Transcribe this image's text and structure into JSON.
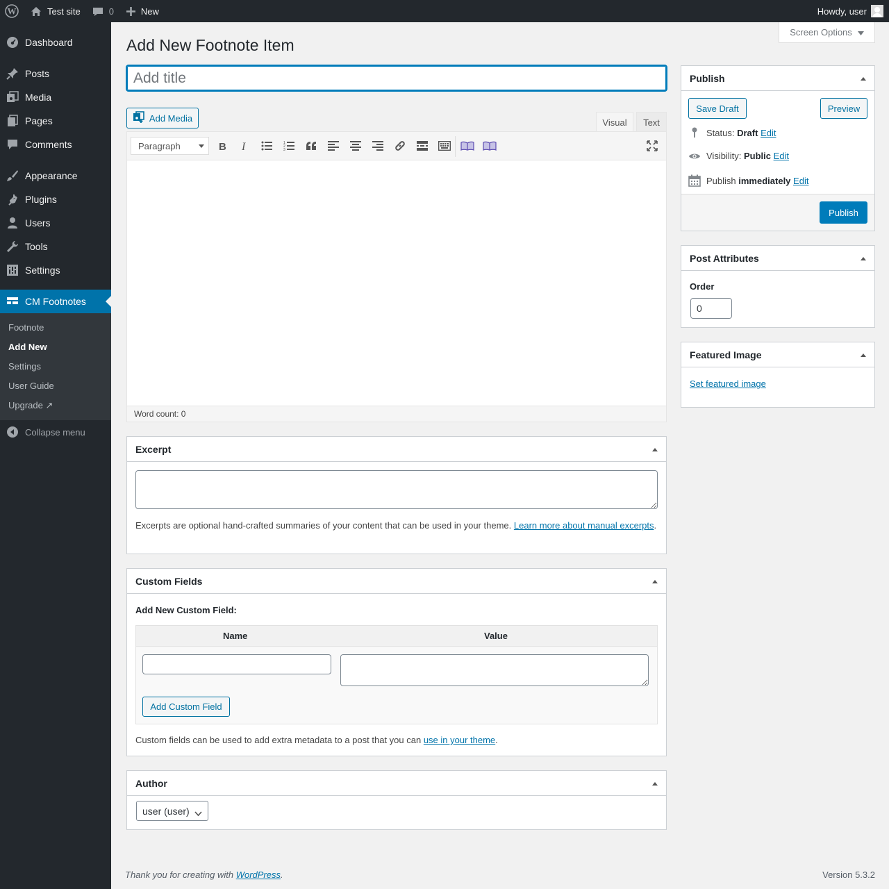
{
  "adminbar": {
    "site_name": "Test site",
    "comments_count": "0",
    "new_label": "New",
    "greeting": "Howdy, user"
  },
  "sidebar": {
    "items": [
      {
        "label": "Dashboard",
        "icon": "dashboard-icon"
      },
      {
        "label": "Posts",
        "icon": "pin-icon"
      },
      {
        "label": "Media",
        "icon": "media-icon"
      },
      {
        "label": "Pages",
        "icon": "pages-icon"
      },
      {
        "label": "Comments",
        "icon": "comment-icon"
      },
      {
        "label": "Appearance",
        "icon": "brush-icon"
      },
      {
        "label": "Plugins",
        "icon": "plug-icon"
      },
      {
        "label": "Users",
        "icon": "user-icon"
      },
      {
        "label": "Tools",
        "icon": "wrench-icon"
      },
      {
        "label": "Settings",
        "icon": "sliders-icon"
      },
      {
        "label": "CM Footnotes",
        "icon": "footnotes-icon"
      }
    ],
    "submenu": [
      "Footnote",
      "Add New",
      "Settings",
      "User Guide",
      "Upgrade ↗"
    ],
    "collapse_label": "Collapse menu"
  },
  "screen_options": "Screen Options",
  "page_title": "Add New Footnote Item",
  "title_placeholder": "Add title",
  "editor": {
    "add_media": "Add Media",
    "tab_visual": "Visual",
    "tab_text": "Text",
    "format": "Paragraph",
    "word_count": "Word count: 0"
  },
  "excerpt": {
    "title": "Excerpt",
    "help": "Excerpts are optional hand-crafted summaries of your content that can be used in your theme.",
    "link": "Learn more about manual excerpts"
  },
  "custom_fields": {
    "title": "Custom Fields",
    "subtitle": "Add New Custom Field:",
    "col_name": "Name",
    "col_value": "Value",
    "add_button": "Add Custom Field",
    "help": "Custom fields can be used to add extra metadata to a post that you can",
    "help_link": "use in your theme"
  },
  "author": {
    "title": "Author",
    "selected": "user (user)"
  },
  "publish": {
    "title": "Publish",
    "save_draft": "Save Draft",
    "preview": "Preview",
    "status_label": "Status:",
    "status_value": "Draft",
    "visibility_label": "Visibility:",
    "visibility_value": "Public",
    "publish_label": "Publish",
    "publish_value": "immediately",
    "edit": "Edit",
    "publish_button": "Publish"
  },
  "post_attributes": {
    "title": "Post Attributes",
    "order_label": "Order",
    "order_value": "0"
  },
  "featured_image": {
    "title": "Featured Image",
    "link": "Set featured image"
  },
  "footer": {
    "thanks": "Thank you for creating with",
    "wp_link": "WordPress",
    "version": "Version 5.3.2"
  },
  "colors": {
    "accent": "#0073aa",
    "adminbar": "#23282d",
    "primary_button": "#007cba"
  }
}
